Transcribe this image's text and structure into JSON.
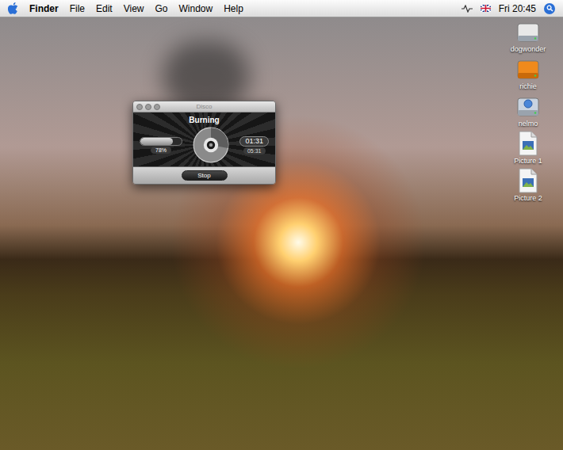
{
  "menu_bar": {
    "app": "Finder",
    "items": [
      "File",
      "Edit",
      "View",
      "Go",
      "Window",
      "Help"
    ],
    "clock": "Fri 20:45"
  },
  "desktop_icons": [
    {
      "label": "dogwonder",
      "kind": "disk"
    },
    {
      "label": "richie",
      "kind": "external"
    },
    {
      "label": "nelmo",
      "kind": "network"
    },
    {
      "label": "Picture 1",
      "kind": "picture"
    },
    {
      "label": "Picture 2",
      "kind": "picture"
    }
  ],
  "window": {
    "title": "Disco",
    "status": "Burning",
    "progress": {
      "level": 0.78,
      "reading": "78%"
    },
    "disc": {
      "level": 0.28
    },
    "time": {
      "elapsed": "01:31",
      "total": "05:31"
    },
    "buttons": [
      "Stop"
    ]
  }
}
